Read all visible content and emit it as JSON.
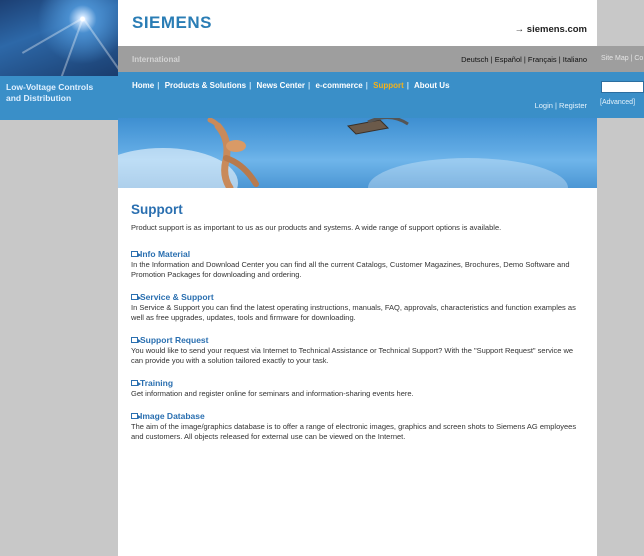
{
  "left": {
    "section_title_line1": "Low-Voltage Controls",
    "section_title_line2": "and Distribution"
  },
  "header": {
    "logo": "SIEMENS",
    "site_link": "→ siemens.com",
    "international": "International",
    "languages": "Deutsch | Español | Français | Italiano"
  },
  "nav": {
    "items": [
      "Home",
      "Products & Solutions",
      "News Center",
      "e-commerce",
      "Support",
      "About Us"
    ],
    "active": "Support",
    "login": "Login | Register"
  },
  "right": {
    "site_map": "Site Map | Co",
    "advanced": "[Advanced]"
  },
  "page": {
    "title": "Support",
    "intro": "Product support is as important to us as our products and systems. A wide range of support options is available.",
    "sections": [
      {
        "title": "Info Material",
        "body": "In the Information and Download Center you can find all the current Catalogs, Customer Magazines, Brochures, Demo Software and Promotion Packages for downloading and ordering."
      },
      {
        "title": "Service & Support",
        "body": "In Service & Support you can find the latest operating instructions, manuals, FAQ, approvals, characteristics and function examples as well as free upgrades, updates, tools and firmware for downloading."
      },
      {
        "title": "Support Request",
        "body": "You would like to send your request via Internet to Technical Assistance or Technical Support? With the \"Support Request\" service we can provide you with a solution tailored exactly to your task."
      },
      {
        "title": "Training",
        "body": "Get information and register online for seminars and information-sharing events here."
      },
      {
        "title": "Image Database",
        "body": "The aim of the image/graphics database is to offer a range of electronic images, graphics and screen shots to Siemens AG employees and customers. All objects released for external use can be viewed on the Internet."
      }
    ]
  },
  "colors": {
    "brand_blue": "#3a8fc8",
    "title_blue": "#2a6fb0",
    "active_nav": "#f3b21a",
    "grey_bar": "#9e9e9e"
  }
}
